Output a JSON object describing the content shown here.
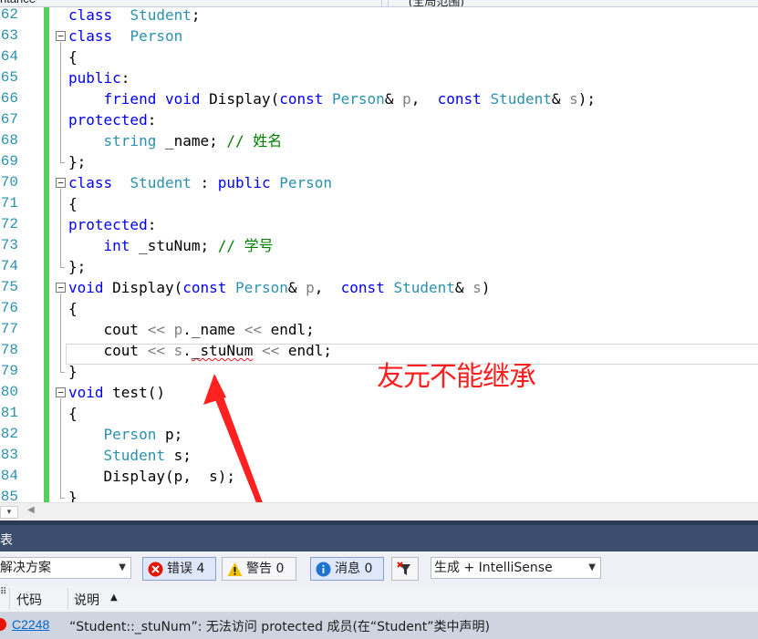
{
  "topbar": {
    "left_tab": "ritance",
    "right_tab": "(全局范围)"
  },
  "editor": {
    "lines": [
      {
        "n": "62",
        "tokens": [
          [
            "kw",
            "class"
          ],
          [
            "",
            "  "
          ],
          [
            "ty",
            "Student"
          ],
          [
            "",
            ";"
          ]
        ]
      },
      {
        "n": "63",
        "tokens": [
          [
            "kw",
            "class"
          ],
          [
            "",
            "  "
          ],
          [
            "ty",
            "Person"
          ]
        ]
      },
      {
        "n": "64",
        "tokens": [
          [
            "",
            "{"
          ]
        ]
      },
      {
        "n": "65",
        "tokens": [
          [
            "kw",
            "public"
          ],
          [
            "",
            ":"
          ]
        ]
      },
      {
        "n": "66",
        "tokens": [
          [
            "",
            "    "
          ],
          [
            "kw",
            "friend"
          ],
          [
            "",
            " "
          ],
          [
            "kw",
            "void"
          ],
          [
            "",
            " Display("
          ],
          [
            "kw",
            "const"
          ],
          [
            "",
            " "
          ],
          [
            "ty",
            "Person"
          ],
          [
            "",
            "& "
          ],
          [
            "pa",
            "p"
          ],
          [
            "",
            ",  "
          ],
          [
            "kw",
            "const"
          ],
          [
            "",
            " "
          ],
          [
            "ty",
            "Student"
          ],
          [
            "",
            "& "
          ],
          [
            "pa",
            "s"
          ],
          [
            "",
            ");"
          ]
        ]
      },
      {
        "n": "67",
        "tokens": [
          [
            "kw",
            "protected"
          ],
          [
            "",
            ":"
          ]
        ]
      },
      {
        "n": "68",
        "tokens": [
          [
            "",
            "    "
          ],
          [
            "ty",
            "string"
          ],
          [
            "",
            " _name; "
          ],
          [
            "cm",
            "// 姓名"
          ]
        ]
      },
      {
        "n": "69",
        "tokens": [
          [
            "",
            "};"
          ]
        ]
      },
      {
        "n": "70",
        "tokens": [
          [
            "kw",
            "class"
          ],
          [
            "",
            "  "
          ],
          [
            "ty",
            "Student"
          ],
          [
            "",
            " : "
          ],
          [
            "kw",
            "public"
          ],
          [
            "",
            " "
          ],
          [
            "ty",
            "Person"
          ]
        ]
      },
      {
        "n": "71",
        "tokens": [
          [
            "",
            "{"
          ]
        ]
      },
      {
        "n": "72",
        "tokens": [
          [
            "kw",
            "protected"
          ],
          [
            "",
            ":"
          ]
        ]
      },
      {
        "n": "73",
        "tokens": [
          [
            "",
            "    "
          ],
          [
            "kw",
            "int"
          ],
          [
            "",
            " _stuNum; "
          ],
          [
            "cm",
            "// 学号"
          ]
        ]
      },
      {
        "n": "74",
        "tokens": [
          [
            "",
            "};"
          ]
        ]
      },
      {
        "n": "75",
        "tokens": [
          [
            "kw",
            "void"
          ],
          [
            "",
            " Display("
          ],
          [
            "kw",
            "const"
          ],
          [
            "",
            " "
          ],
          [
            "ty",
            "Person"
          ],
          [
            "",
            "& "
          ],
          [
            "pa",
            "p"
          ],
          [
            "",
            ",  "
          ],
          [
            "kw",
            "const"
          ],
          [
            "",
            " "
          ],
          [
            "ty",
            "Student"
          ],
          [
            "",
            "& "
          ],
          [
            "pa",
            "s"
          ],
          [
            "",
            ")"
          ]
        ]
      },
      {
        "n": "76",
        "tokens": [
          [
            "",
            "{"
          ]
        ]
      },
      {
        "n": "77",
        "tokens": [
          [
            "",
            "    cout "
          ],
          [
            "pa",
            "<<"
          ],
          [
            "",
            " "
          ],
          [
            "pa",
            "p"
          ],
          [
            "",
            "._name "
          ],
          [
            "pa",
            "<<"
          ],
          [
            "",
            " endl;"
          ]
        ]
      },
      {
        "n": "78",
        "tokens": [
          [
            "",
            "    cout "
          ],
          [
            "pa",
            "<<"
          ],
          [
            "",
            " "
          ],
          [
            "pa",
            "s"
          ],
          [
            "",
            "."
          ],
          [
            "squig",
            "_stuNum"
          ],
          [
            "",
            " "
          ],
          [
            "pa",
            "<<"
          ],
          [
            "",
            " endl;"
          ]
        ]
      },
      {
        "n": "79",
        "tokens": [
          [
            "",
            "}"
          ]
        ]
      },
      {
        "n": "80",
        "tokens": [
          [
            "kw",
            "void"
          ],
          [
            "",
            " test()"
          ]
        ]
      },
      {
        "n": "81",
        "tokens": [
          [
            "",
            "{"
          ]
        ]
      },
      {
        "n": "82",
        "tokens": [
          [
            "",
            "    "
          ],
          [
            "ty",
            "Person"
          ],
          [
            "",
            " p;"
          ]
        ]
      },
      {
        "n": "83",
        "tokens": [
          [
            "",
            "    "
          ],
          [
            "ty",
            "Student"
          ],
          [
            "",
            " s;"
          ]
        ]
      },
      {
        "n": "84",
        "tokens": [
          [
            "",
            "    Display(p,  s);"
          ]
        ]
      },
      {
        "n": "85",
        "tokens": [
          [
            "",
            "}"
          ]
        ]
      }
    ],
    "annotation": "友元不能继承"
  },
  "panel": {
    "title": "表",
    "scope_dropdown": "解决方案",
    "errors_label": "错误 4",
    "warnings_label": "警告 0",
    "messages_label": "消息 0",
    "build_dropdown": "生成 + IntelliSense",
    "col_code": "代码",
    "col_desc": "说明",
    "sort_indicator": "▲",
    "row": {
      "code": "C2248",
      "description": "“Student::_stuNum”: 无法访问 protected 成员(在“Student”类中声明)"
    }
  },
  "colors": {
    "keyword": "#0000ff",
    "type": "#2b91af",
    "comment": "#008000",
    "annotation": "#ff1e1e",
    "error": "#e51400",
    "panel_header": "#3c4e6e"
  }
}
